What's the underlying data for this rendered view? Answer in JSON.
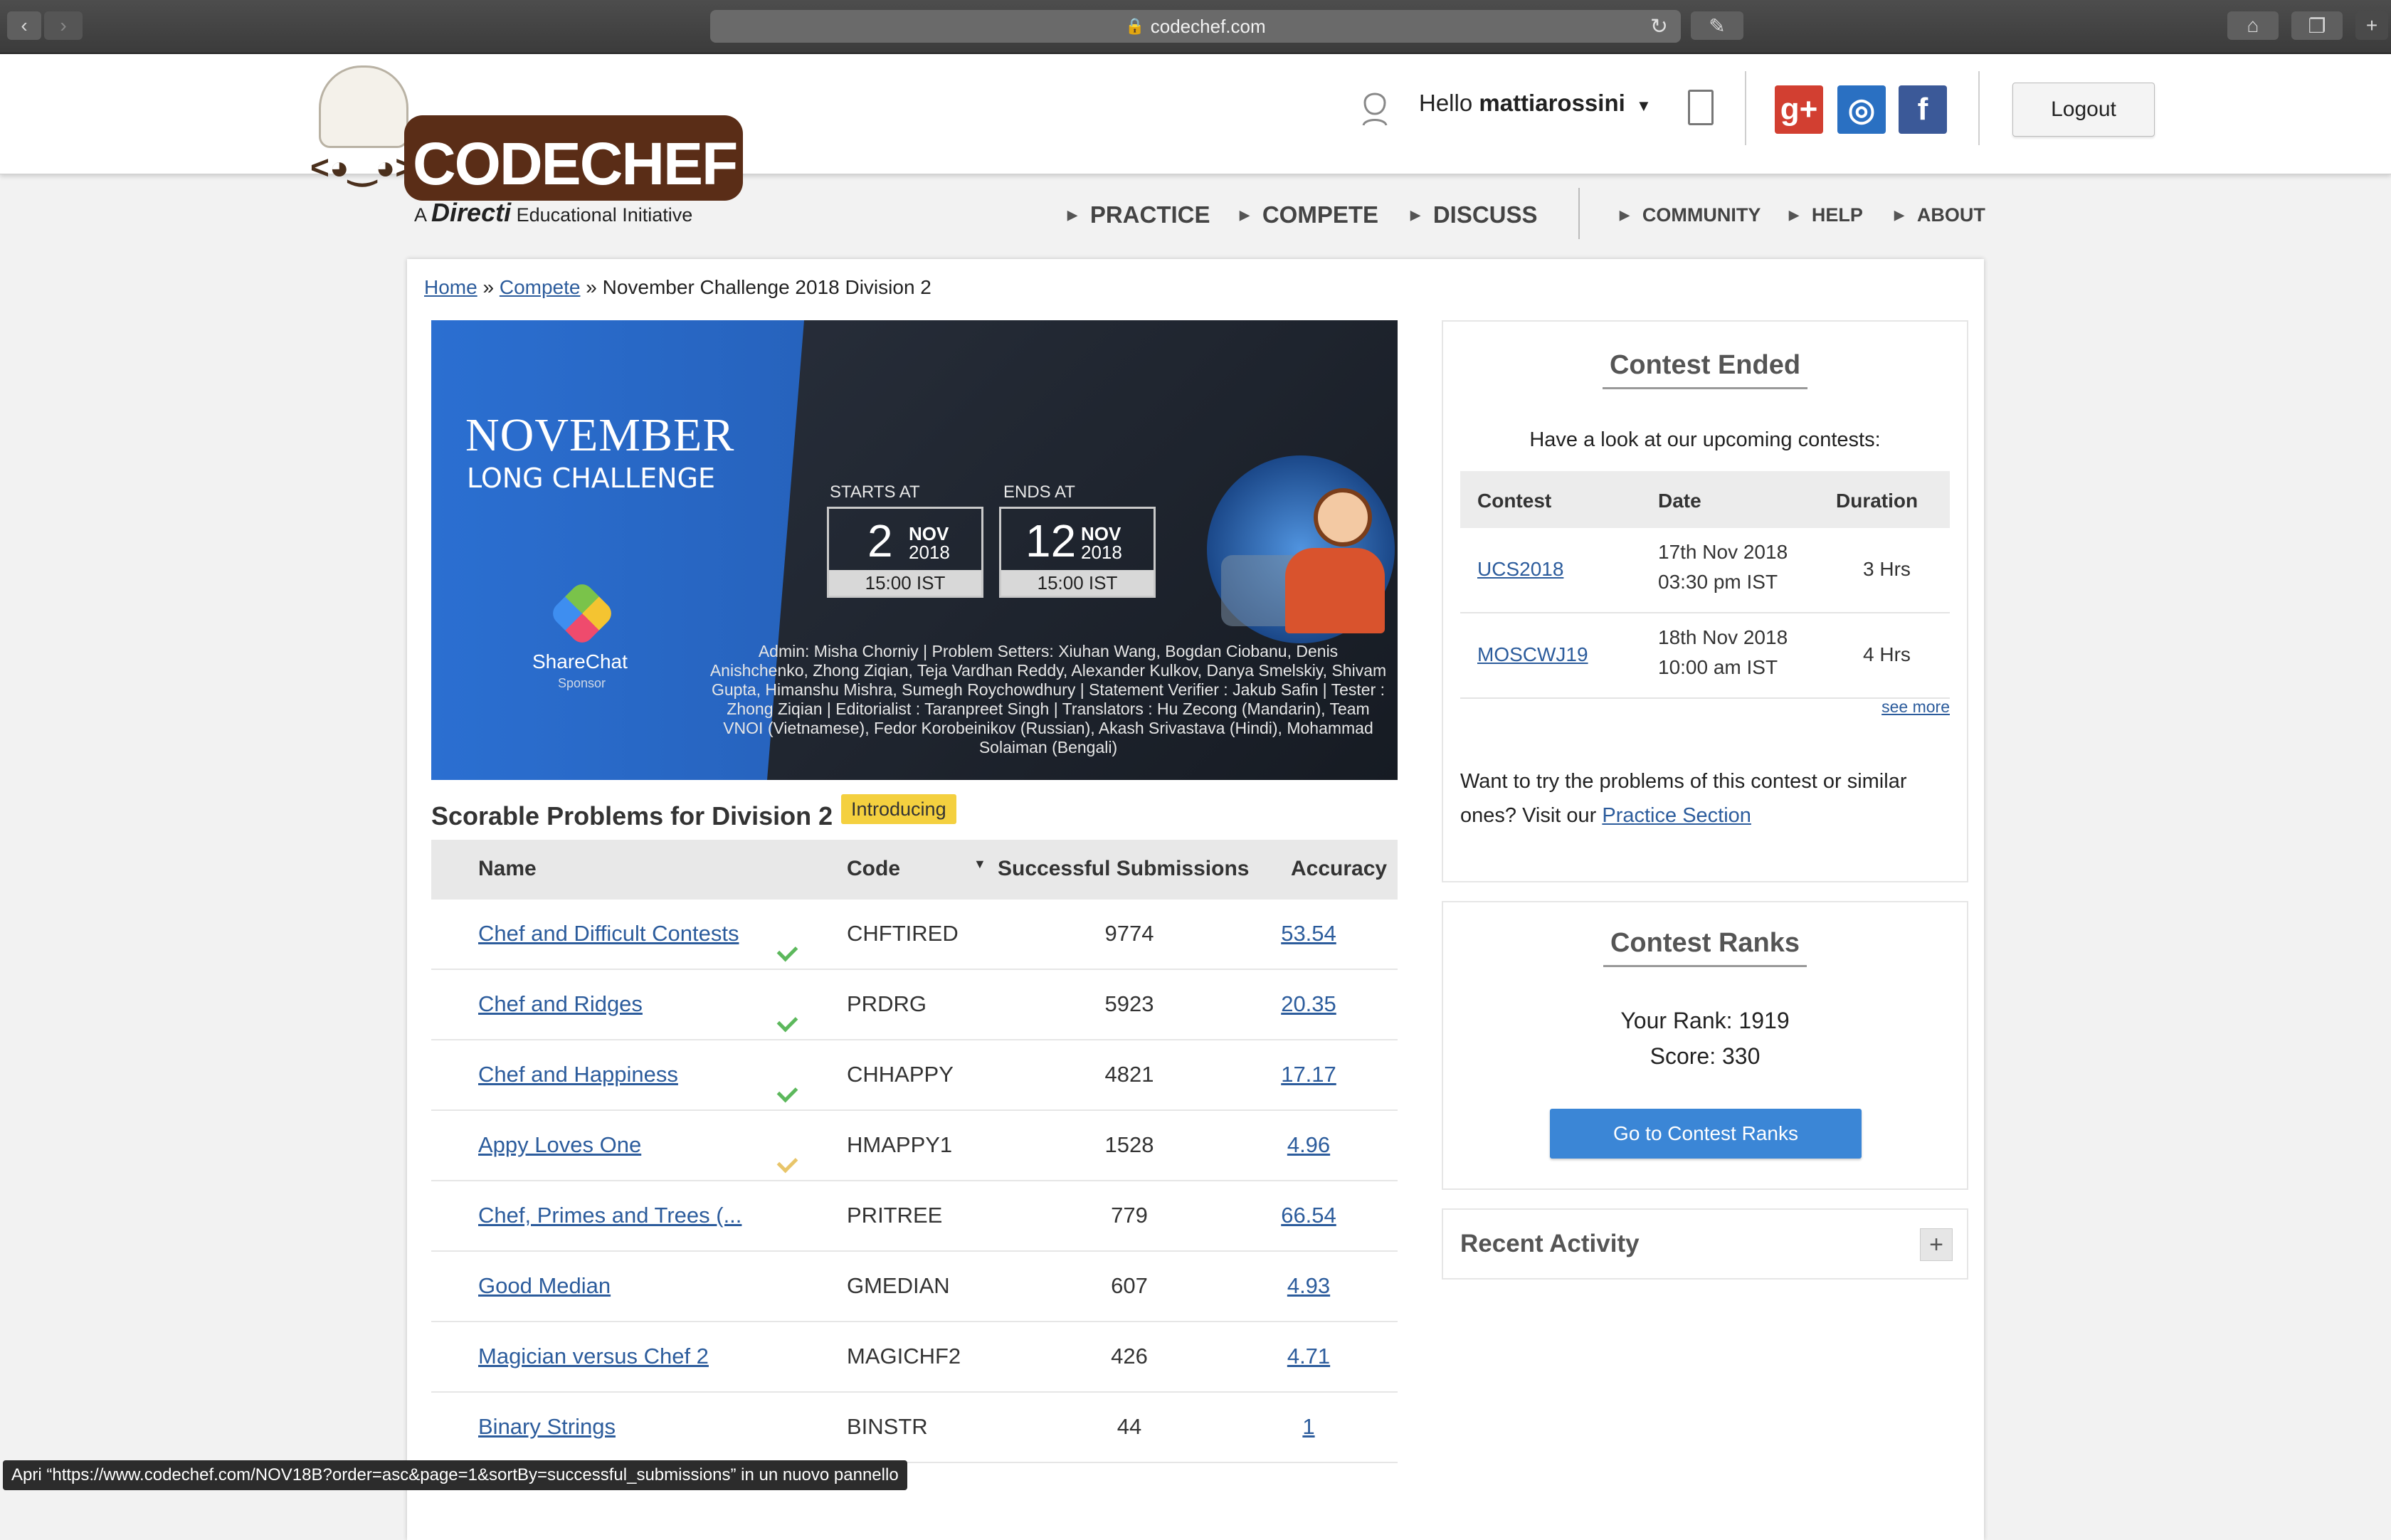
{
  "browser": {
    "url": "codechef.com"
  },
  "header": {
    "logo_text": "CODECHEF",
    "logo_tag_prefix": "A",
    "logo_tag_brand": "Directi",
    "logo_tag_suffix": "Educational Initiative",
    "hello": "Hello",
    "username": "mattiarossini",
    "logout": "Logout",
    "social": [
      {
        "icon": "google-plus-icon",
        "glyph": "g+",
        "color": "#d23f31"
      },
      {
        "icon": "github-icon",
        "glyph": "◎",
        "color": "#2a70c2"
      },
      {
        "icon": "facebook-icon",
        "glyph": "f",
        "color": "#3b5998"
      }
    ],
    "nav_main": [
      "PRACTICE",
      "COMPETE",
      "DISCUSS"
    ],
    "nav_secondary": [
      "COMMUNITY",
      "HELP",
      "ABOUT"
    ]
  },
  "breadcrumb": {
    "home": "Home",
    "sep": "»",
    "compete": "Compete",
    "current": "November Challenge 2018 Division 2"
  },
  "banner": {
    "title": "NOVEMBER",
    "subtitle": "LONG CHALLENGE",
    "sponsor_name": "ShareChat",
    "sponsor_label": "Sponsor",
    "starts_label": "STARTS AT",
    "ends_label": "ENDS AT",
    "start": {
      "day": "2",
      "month": "NOV",
      "year": "2018",
      "time": "15:00 IST"
    },
    "end": {
      "day": "12",
      "month": "NOV",
      "year": "2018",
      "time": "15:00 IST"
    },
    "credits": "Admin: Misha Chorniy | Problem Setters: Xiuhan Wang, Bogdan Ciobanu, Denis Anishchenko, Zhong Ziqian, Teja Vardhan Reddy, Alexander Kulkov, Danya Smelskiy, Shivam Gupta, Himanshu Mishra, Sumegh Roychowdhury | Statement Verifier : Jakub Safin | Tester : Zhong Ziqian | Editorialist : Taranpreet Singh | Translators : Hu Zecong (Mandarin), Team VNOI (Vietnamese), Fedor Korobeinikov (Russian), Akash Srivastava (Hindi), Mohammad Solaiman (Bengali)"
  },
  "problems": {
    "title": "Scorable Problems for Division 2",
    "badge": "Introducing",
    "headers": {
      "name": "Name",
      "code": "Code",
      "sort_indicator": "▼",
      "submissions": "Successful Submissions",
      "accuracy": "Accuracy"
    },
    "rows": [
      {
        "name": "Chef and Difficult Contests",
        "status": "solved",
        "code": "CHFTIRED",
        "submissions": "9774",
        "accuracy": "53.54"
      },
      {
        "name": "Chef and Ridges",
        "status": "solved",
        "code": "PRDRG",
        "submissions": "5923",
        "accuracy": "20.35"
      },
      {
        "name": "Chef and Happiness",
        "status": "solved",
        "code": "CHHAPPY",
        "submissions": "4821",
        "accuracy": "17.17"
      },
      {
        "name": "Appy Loves One",
        "status": "partial",
        "code": "HMAPPY1",
        "submissions": "1528",
        "accuracy": "4.96"
      },
      {
        "name": "Chef, Primes and Trees (...",
        "status": "none",
        "code": "PRITREE",
        "submissions": "779",
        "accuracy": "66.54"
      },
      {
        "name": "Good Median",
        "status": "none",
        "code": "GMEDIAN",
        "submissions": "607",
        "accuracy": "4.93"
      },
      {
        "name": "Magician versus Chef 2",
        "status": "none",
        "code": "MAGICHF2",
        "submissions": "426",
        "accuracy": "4.71"
      },
      {
        "name": "Binary Strings",
        "status": "none",
        "code": "BINSTR",
        "submissions": "44",
        "accuracy": "1"
      }
    ]
  },
  "sidebar": {
    "contest_ended": {
      "title": "Contest Ended",
      "intro": "Have a look at our upcoming contests:",
      "headers": {
        "contest": "Contest",
        "date": "Date",
        "duration": "Duration"
      },
      "rows": [
        {
          "code": "UCS2018",
          "date_line1": "17th Nov 2018",
          "date_line2": "03:30 pm IST",
          "duration": "3 Hrs"
        },
        {
          "code": "MOSCWJ19",
          "date_line1": "18th Nov 2018",
          "date_line2": "10:00 am IST",
          "duration": "4 Hrs"
        }
      ],
      "see_more": "see more",
      "practice_text": "Want to try the problems of this contest or similar ones? Visit our",
      "practice_link": "Practice Section"
    },
    "ranks": {
      "title": "Contest Ranks",
      "rank_line": "Your Rank: 1919",
      "score_line": "Score: 330",
      "button": "Go to Contest Ranks"
    },
    "recent": {
      "title": "Recent Activity",
      "toggle": "+"
    }
  },
  "status_bar": "Apri “https://www.codechef.com/NOV18B?order=asc&page=1&sortBy=successful_submissions” in un nuovo pannello"
}
